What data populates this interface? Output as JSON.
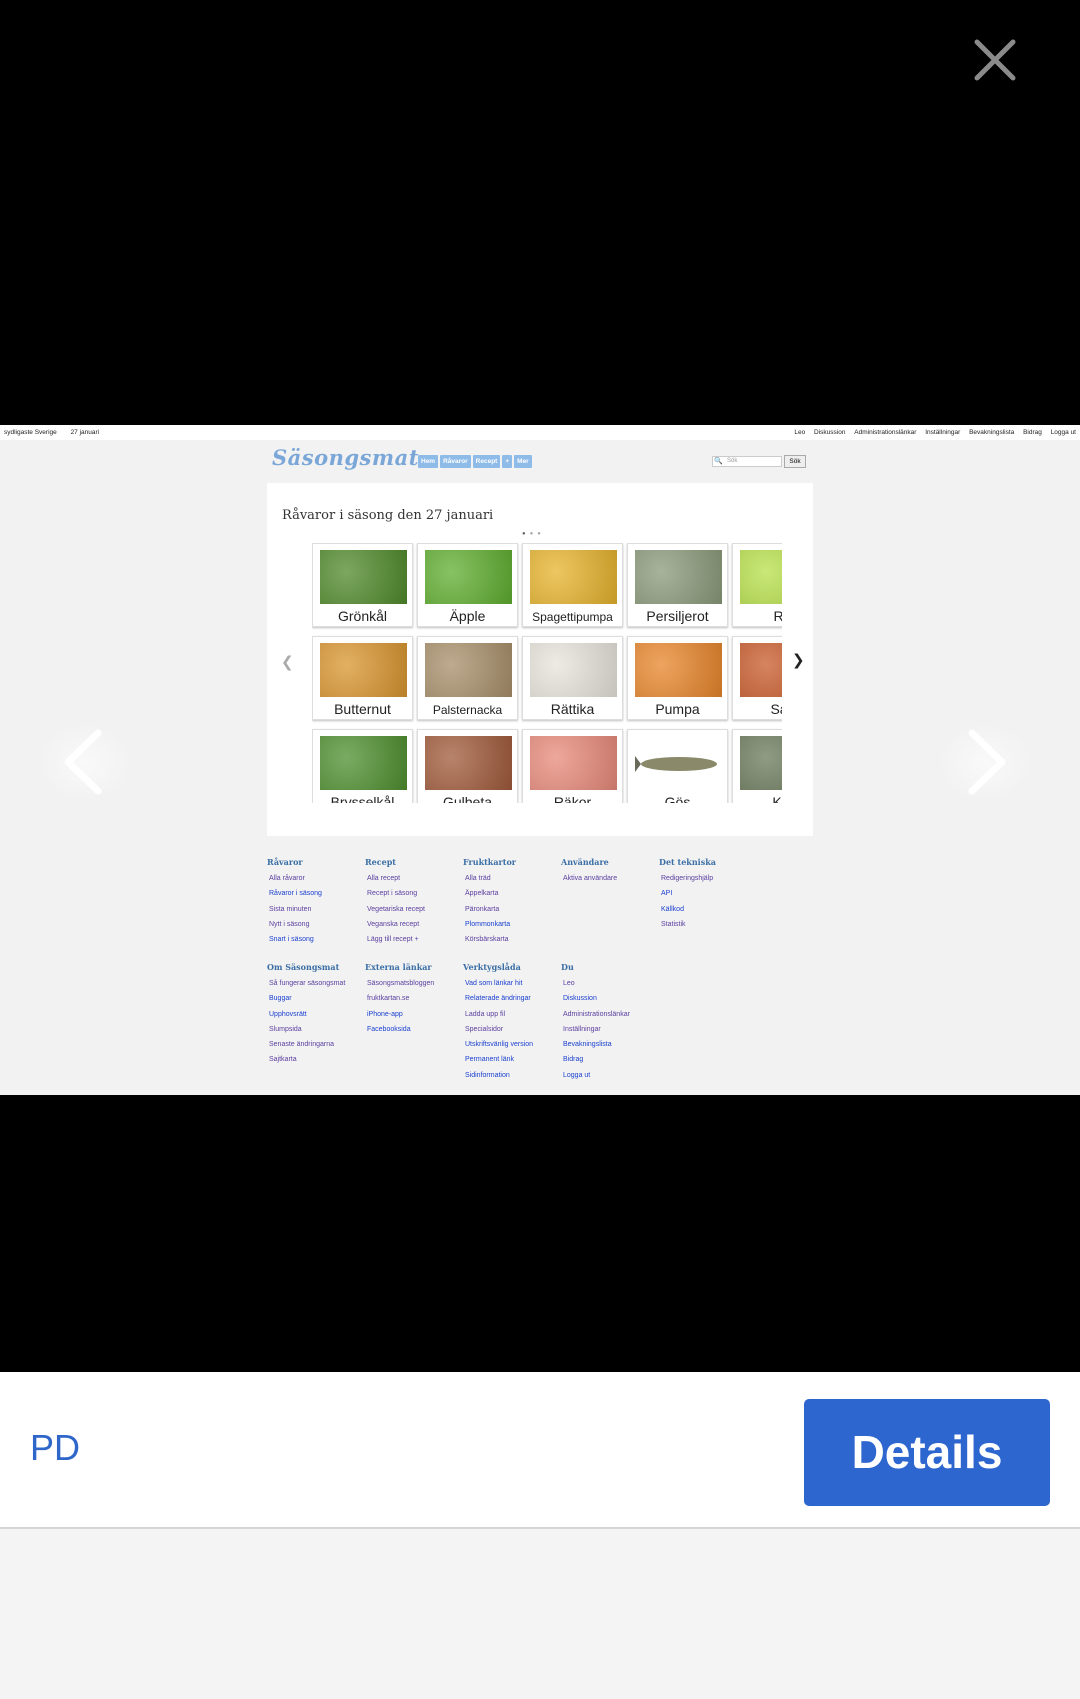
{
  "viewer": {
    "close_icon": "close-icon",
    "prev_icon": "chevron-left-icon",
    "next_icon": "chevron-right-icon"
  },
  "shot": {
    "topbar_left": [
      "sydligaste Sverige",
      "27 januari"
    ],
    "topbar_right": [
      "Leo",
      "Diskussion",
      "Administrationslänkar",
      "Inställningar",
      "Bevakningslista",
      "Bidrag",
      "Logga ut"
    ],
    "logo": "Säsongsmat",
    "menu": [
      "Hem",
      "Råvaror",
      "Recept",
      "+",
      "Mer"
    ],
    "search_placeholder": "Sök",
    "search_button": "Sök",
    "panel_title": "Råvaror i säsong den 27 januari",
    "items": [
      {
        "label": "Grönkål",
        "color": "#4f8a2a"
      },
      {
        "label": "Äpple",
        "color": "#5fae2f"
      },
      {
        "label": "Spagettipumpa",
        "color": "#e6b32c"
      },
      {
        "label": "Persiljerot",
        "color": "#8a9a7a"
      },
      {
        "label": "Rö",
        "color": "#b7e04a"
      },
      {
        "label": "Butternut",
        "color": "#d9952e"
      },
      {
        "label": "Palsternacka",
        "color": "#a88f6a"
      },
      {
        "label": "Rättika",
        "color": "#e8e4dc"
      },
      {
        "label": "Pumpa",
        "color": "#e8862a"
      },
      {
        "label": "Sav",
        "color": "#c85a2a"
      },
      {
        "label": "Brysselkål",
        "color": "#4e8f2e"
      },
      {
        "label": "Gulbeta",
        "color": "#a05a3a"
      },
      {
        "label": "Räkor",
        "color": "#e88a7a"
      },
      {
        "label": "Gös",
        "color": "#ffffff"
      },
      {
        "label": "Kål",
        "color": "#6a7a5a"
      }
    ],
    "footer": [
      {
        "title": "Råvaror",
        "links": [
          "Alla råvaror",
          "Råvaror i säsong",
          "Sista minuten",
          "Nytt i säsong",
          "Snart i säsong"
        ]
      },
      {
        "title": "Recept",
        "links": [
          "Alla recept",
          "Recept i säsong",
          "Vegetariska recept",
          "Veganska recept",
          "Lägg till recept +"
        ]
      },
      {
        "title": "Fruktkartor",
        "links": [
          "Alla träd",
          "Äppelkarta",
          "Päronkarta",
          "Plommonkarta",
          "Körsbärskarta"
        ]
      },
      {
        "title": "Användare",
        "links": [
          "Aktiva användare"
        ]
      },
      {
        "title": "Det tekniska",
        "links": [
          "Redigeringshjälp",
          "API",
          "Källkod",
          "Statistik"
        ]
      },
      {
        "title": "Om Säsongsmat",
        "links": [
          "Så fungerar säsongsmat",
          "Buggar",
          "Upphovsrätt",
          "Slumpsida",
          "Senaste ändringarna",
          "Sajtkarta"
        ]
      },
      {
        "title": "Externa länkar",
        "links": [
          "Säsongsmatsbloggen",
          "fruktkartan.se",
          "iPhone-app",
          "Facebooksida"
        ]
      },
      {
        "title": "Verktygslåda",
        "links": [
          "Vad som länkar hit",
          "Relaterade ändringar",
          "Ladda upp fil",
          "Specialsidor",
          "Utskriftsvänlig version",
          "Permanent länk",
          "Sidinformation"
        ]
      },
      {
        "title": "Du",
        "links": [
          "Leo",
          "Diskussion",
          "Administrationslänkar",
          "Inställningar",
          "Bevakningslista",
          "Bidrag",
          "Logga ut"
        ]
      }
    ]
  },
  "bottom": {
    "license": "PD",
    "details_label": "Details",
    "accent": "#2e66d0"
  }
}
